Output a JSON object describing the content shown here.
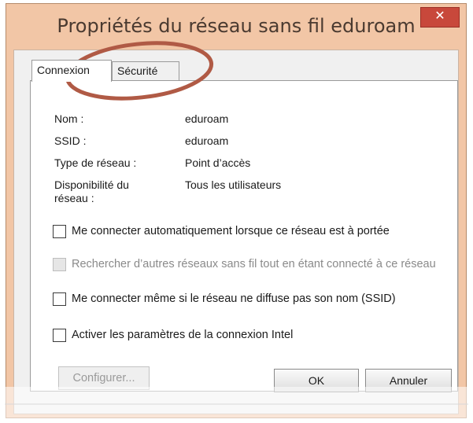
{
  "window": {
    "title": "Propriétés du réseau sans fil eduroam",
    "close_symbol": "✕"
  },
  "tabs": [
    {
      "label": "Connexion"
    },
    {
      "label": "Sécurité"
    }
  ],
  "properties": [
    {
      "label": "Nom :",
      "value": "eduroam"
    },
    {
      "label": "SSID :",
      "value": "eduroam"
    },
    {
      "label": "Type de réseau :",
      "value": "Point d’accès"
    },
    {
      "label": "Disponibilité du réseau :",
      "value": "Tous les utilisateurs"
    }
  ],
  "options": [
    {
      "label": "Me connecter automatiquement lorsque ce réseau est à portée",
      "checked": false,
      "enabled": true
    },
    {
      "label": "Rechercher d’autres réseaux sans fil tout en étant connecté à ce réseau",
      "checked": false,
      "enabled": false
    },
    {
      "label": "Me connecter même si le réseau ne diffuse pas son nom (SSID)",
      "checked": false,
      "enabled": true
    },
    {
      "label": "Activer les paramètres de la connexion Intel",
      "checked": false,
      "enabled": true
    }
  ],
  "buttons": {
    "configure": "Configurer...",
    "ok": "OK",
    "cancel": "Annuler"
  },
  "colors": {
    "title_bar": "#f2c6a6",
    "close_button": "#c8483b",
    "annotation_circle": "#b05a45"
  }
}
